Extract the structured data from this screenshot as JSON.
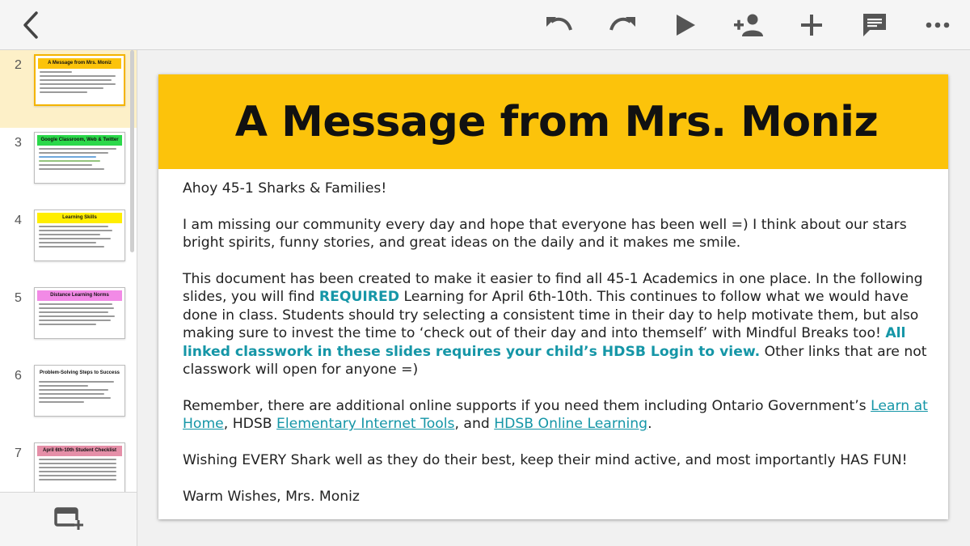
{
  "toolbar": {
    "back": "back-arrow-icon",
    "undo": "undo-icon",
    "redo": "redo-icon",
    "present": "play-icon",
    "share": "add-person-icon",
    "insert": "plus-icon",
    "comments": "comment-icon",
    "more": "more-horizontal-icon"
  },
  "filmstrip": {
    "slides": [
      {
        "number": "2",
        "title": "A Message from Mrs. Moniz",
        "color": "#fcc30b"
      },
      {
        "number": "3",
        "title": "Google Classroom, Web & Twitter",
        "color": "#2bd84a"
      },
      {
        "number": "4",
        "title": "Learning Skills",
        "color": "#ffee00"
      },
      {
        "number": "5",
        "title": "Distance Learning Norms",
        "color": "#f28ae6"
      },
      {
        "number": "6",
        "title": "Problem-Solving Steps to Success",
        "color": "#ffffff"
      },
      {
        "number": "7",
        "title": "April 6th-10th Student Checklist",
        "color": "#e58fa8"
      }
    ],
    "new_slide": "new-slide-icon"
  },
  "slide": {
    "title": "A Message from Mrs. Moniz",
    "greeting": "Ahoy 45-1 Sharks & Families!",
    "p1": "I am missing our community every day and hope that everyone has been well =) I think about our stars bright spirits, funny stories, and great ideas on the daily and it makes me smile.",
    "p2_a": "This document has been created to make it easier to find all 45-1 Academics in one place. In the following slides, you will find ",
    "p2_required": "REQUIRED",
    "p2_b": " Learning for April 6th-10th. This continues to follow what we would have done in class. Students should try selecting a consistent time in their day to help motivate them, but also making sure to invest the time to ‘check out of their day and into themself’ with Mindful Breaks too! ",
    "p2_bold": "All linked classwork in these slides requires your child’s HDSB Login to view.",
    "p2_c": " Other links that are not classwork will open for anyone =)",
    "p3_a": "Remember, there are additional online supports if you need them including Ontario Government’s ",
    "link1": "Learn at Home",
    "p3_b": ", HDSB ",
    "link2": "Elementary Internet Tools",
    "p3_c": ", and ",
    "link3": "HDSB Online Learning",
    "p3_d": ".",
    "p4": "Wishing EVERY Shark well as they do their best, keep their mind active, and most importantly HAS FUN!",
    "signoff": "Warm Wishes, Mrs. Moniz"
  }
}
